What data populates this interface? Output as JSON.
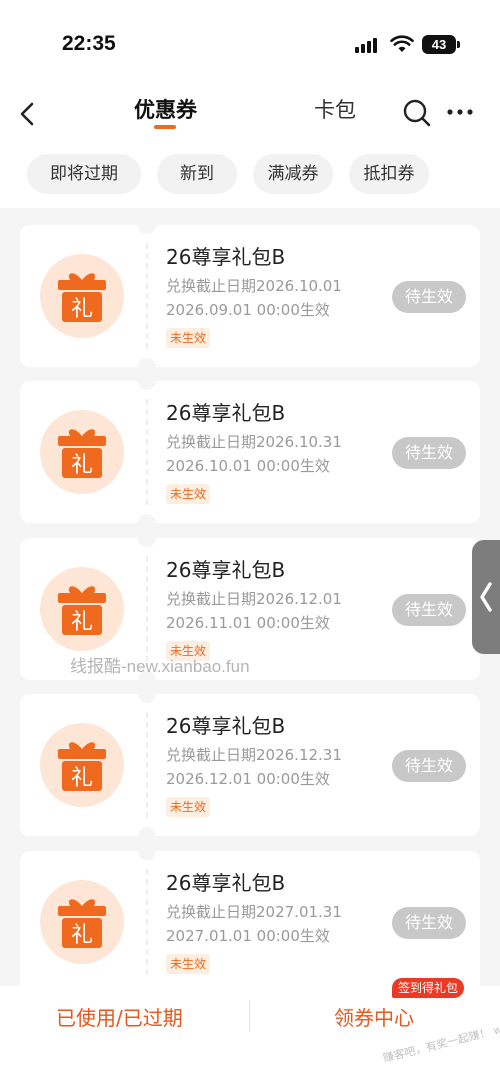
{
  "status_bar": {
    "time": "22:35",
    "battery": "43"
  },
  "nav": {
    "tab_active": "优惠券",
    "tab_cardbag": "卡包"
  },
  "filters": [
    "即将过期",
    "新到",
    "满减券",
    "抵扣券"
  ],
  "coupons": [
    {
      "title": "26尊享礼包B",
      "line1": "兑换截止日期2026.10.01",
      "line2": "2026.09.01 00:00生效",
      "badge": "未生效",
      "status": "待生效",
      "icon_text": "礼"
    },
    {
      "title": "26尊享礼包B",
      "line1": "兑换截止日期2026.10.31",
      "line2": "2026.10.01 00:00生效",
      "badge": "未生效",
      "status": "待生效",
      "icon_text": "礼"
    },
    {
      "title": "26尊享礼包B",
      "line1": "兑换截止日期2026.12.01",
      "line2": "2026.11.01 00:00生效",
      "badge": "未生效",
      "status": "待生效",
      "icon_text": "礼"
    },
    {
      "title": "26尊享礼包B",
      "line1": "兑换截止日期2026.12.31",
      "line2": "2026.12.01 00:00生效",
      "badge": "未生效",
      "status": "待生效",
      "icon_text": "礼"
    },
    {
      "title": "26尊享礼包B",
      "line1": "兑换截止日期2027.01.31",
      "line2": "2027.01.01 00:00生效",
      "badge": "未生效",
      "status": "待生效",
      "icon_text": "礼"
    }
  ],
  "watermark": "线报酷-new.xianbao.fun",
  "bottom": {
    "used_expired": "已使用/已过期",
    "coupon_center": "领券中心",
    "signin_badge": "签到得礼包",
    "corner_watermark": "赚客吧，有奖一起赚！ www.zuanke8.com"
  },
  "colors": {
    "accent": "#ef6a1e",
    "badge_red": "#e83a24",
    "status_gray": "#c8c8c8"
  }
}
